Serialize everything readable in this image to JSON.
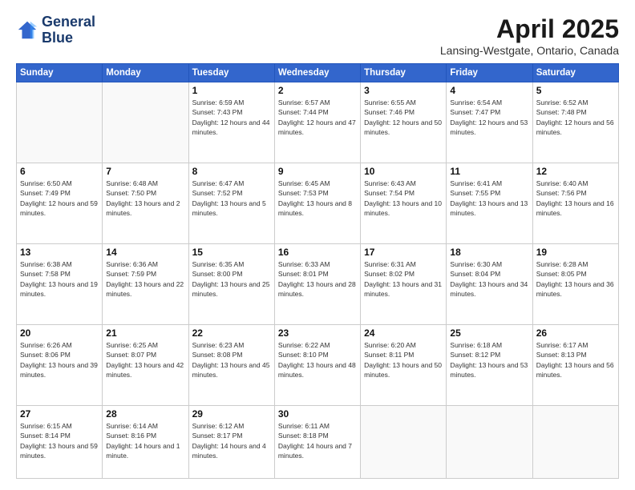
{
  "header": {
    "logo_line1": "General",
    "logo_line2": "Blue",
    "month": "April 2025",
    "location": "Lansing-Westgate, Ontario, Canada"
  },
  "weekdays": [
    "Sunday",
    "Monday",
    "Tuesday",
    "Wednesday",
    "Thursday",
    "Friday",
    "Saturday"
  ],
  "weeks": [
    [
      {
        "day": "",
        "sunrise": "",
        "sunset": "",
        "daylight": ""
      },
      {
        "day": "",
        "sunrise": "",
        "sunset": "",
        "daylight": ""
      },
      {
        "day": "1",
        "sunrise": "Sunrise: 6:59 AM",
        "sunset": "Sunset: 7:43 PM",
        "daylight": "Daylight: 12 hours and 44 minutes."
      },
      {
        "day": "2",
        "sunrise": "Sunrise: 6:57 AM",
        "sunset": "Sunset: 7:44 PM",
        "daylight": "Daylight: 12 hours and 47 minutes."
      },
      {
        "day": "3",
        "sunrise": "Sunrise: 6:55 AM",
        "sunset": "Sunset: 7:46 PM",
        "daylight": "Daylight: 12 hours and 50 minutes."
      },
      {
        "day": "4",
        "sunrise": "Sunrise: 6:54 AM",
        "sunset": "Sunset: 7:47 PM",
        "daylight": "Daylight: 12 hours and 53 minutes."
      },
      {
        "day": "5",
        "sunrise": "Sunrise: 6:52 AM",
        "sunset": "Sunset: 7:48 PM",
        "daylight": "Daylight: 12 hours and 56 minutes."
      }
    ],
    [
      {
        "day": "6",
        "sunrise": "Sunrise: 6:50 AM",
        "sunset": "Sunset: 7:49 PM",
        "daylight": "Daylight: 12 hours and 59 minutes."
      },
      {
        "day": "7",
        "sunrise": "Sunrise: 6:48 AM",
        "sunset": "Sunset: 7:50 PM",
        "daylight": "Daylight: 13 hours and 2 minutes."
      },
      {
        "day": "8",
        "sunrise": "Sunrise: 6:47 AM",
        "sunset": "Sunset: 7:52 PM",
        "daylight": "Daylight: 13 hours and 5 minutes."
      },
      {
        "day": "9",
        "sunrise": "Sunrise: 6:45 AM",
        "sunset": "Sunset: 7:53 PM",
        "daylight": "Daylight: 13 hours and 8 minutes."
      },
      {
        "day": "10",
        "sunrise": "Sunrise: 6:43 AM",
        "sunset": "Sunset: 7:54 PM",
        "daylight": "Daylight: 13 hours and 10 minutes."
      },
      {
        "day": "11",
        "sunrise": "Sunrise: 6:41 AM",
        "sunset": "Sunset: 7:55 PM",
        "daylight": "Daylight: 13 hours and 13 minutes."
      },
      {
        "day": "12",
        "sunrise": "Sunrise: 6:40 AM",
        "sunset": "Sunset: 7:56 PM",
        "daylight": "Daylight: 13 hours and 16 minutes."
      }
    ],
    [
      {
        "day": "13",
        "sunrise": "Sunrise: 6:38 AM",
        "sunset": "Sunset: 7:58 PM",
        "daylight": "Daylight: 13 hours and 19 minutes."
      },
      {
        "day": "14",
        "sunrise": "Sunrise: 6:36 AM",
        "sunset": "Sunset: 7:59 PM",
        "daylight": "Daylight: 13 hours and 22 minutes."
      },
      {
        "day": "15",
        "sunrise": "Sunrise: 6:35 AM",
        "sunset": "Sunset: 8:00 PM",
        "daylight": "Daylight: 13 hours and 25 minutes."
      },
      {
        "day": "16",
        "sunrise": "Sunrise: 6:33 AM",
        "sunset": "Sunset: 8:01 PM",
        "daylight": "Daylight: 13 hours and 28 minutes."
      },
      {
        "day": "17",
        "sunrise": "Sunrise: 6:31 AM",
        "sunset": "Sunset: 8:02 PM",
        "daylight": "Daylight: 13 hours and 31 minutes."
      },
      {
        "day": "18",
        "sunrise": "Sunrise: 6:30 AM",
        "sunset": "Sunset: 8:04 PM",
        "daylight": "Daylight: 13 hours and 34 minutes."
      },
      {
        "day": "19",
        "sunrise": "Sunrise: 6:28 AM",
        "sunset": "Sunset: 8:05 PM",
        "daylight": "Daylight: 13 hours and 36 minutes."
      }
    ],
    [
      {
        "day": "20",
        "sunrise": "Sunrise: 6:26 AM",
        "sunset": "Sunset: 8:06 PM",
        "daylight": "Daylight: 13 hours and 39 minutes."
      },
      {
        "day": "21",
        "sunrise": "Sunrise: 6:25 AM",
        "sunset": "Sunset: 8:07 PM",
        "daylight": "Daylight: 13 hours and 42 minutes."
      },
      {
        "day": "22",
        "sunrise": "Sunrise: 6:23 AM",
        "sunset": "Sunset: 8:08 PM",
        "daylight": "Daylight: 13 hours and 45 minutes."
      },
      {
        "day": "23",
        "sunrise": "Sunrise: 6:22 AM",
        "sunset": "Sunset: 8:10 PM",
        "daylight": "Daylight: 13 hours and 48 minutes."
      },
      {
        "day": "24",
        "sunrise": "Sunrise: 6:20 AM",
        "sunset": "Sunset: 8:11 PM",
        "daylight": "Daylight: 13 hours and 50 minutes."
      },
      {
        "day": "25",
        "sunrise": "Sunrise: 6:18 AM",
        "sunset": "Sunset: 8:12 PM",
        "daylight": "Daylight: 13 hours and 53 minutes."
      },
      {
        "day": "26",
        "sunrise": "Sunrise: 6:17 AM",
        "sunset": "Sunset: 8:13 PM",
        "daylight": "Daylight: 13 hours and 56 minutes."
      }
    ],
    [
      {
        "day": "27",
        "sunrise": "Sunrise: 6:15 AM",
        "sunset": "Sunset: 8:14 PM",
        "daylight": "Daylight: 13 hours and 59 minutes."
      },
      {
        "day": "28",
        "sunrise": "Sunrise: 6:14 AM",
        "sunset": "Sunset: 8:16 PM",
        "daylight": "Daylight: 14 hours and 1 minute."
      },
      {
        "day": "29",
        "sunrise": "Sunrise: 6:12 AM",
        "sunset": "Sunset: 8:17 PM",
        "daylight": "Daylight: 14 hours and 4 minutes."
      },
      {
        "day": "30",
        "sunrise": "Sunrise: 6:11 AM",
        "sunset": "Sunset: 8:18 PM",
        "daylight": "Daylight: 14 hours and 7 minutes."
      },
      {
        "day": "",
        "sunrise": "",
        "sunset": "",
        "daylight": ""
      },
      {
        "day": "",
        "sunrise": "",
        "sunset": "",
        "daylight": ""
      },
      {
        "day": "",
        "sunrise": "",
        "sunset": "",
        "daylight": ""
      }
    ]
  ]
}
